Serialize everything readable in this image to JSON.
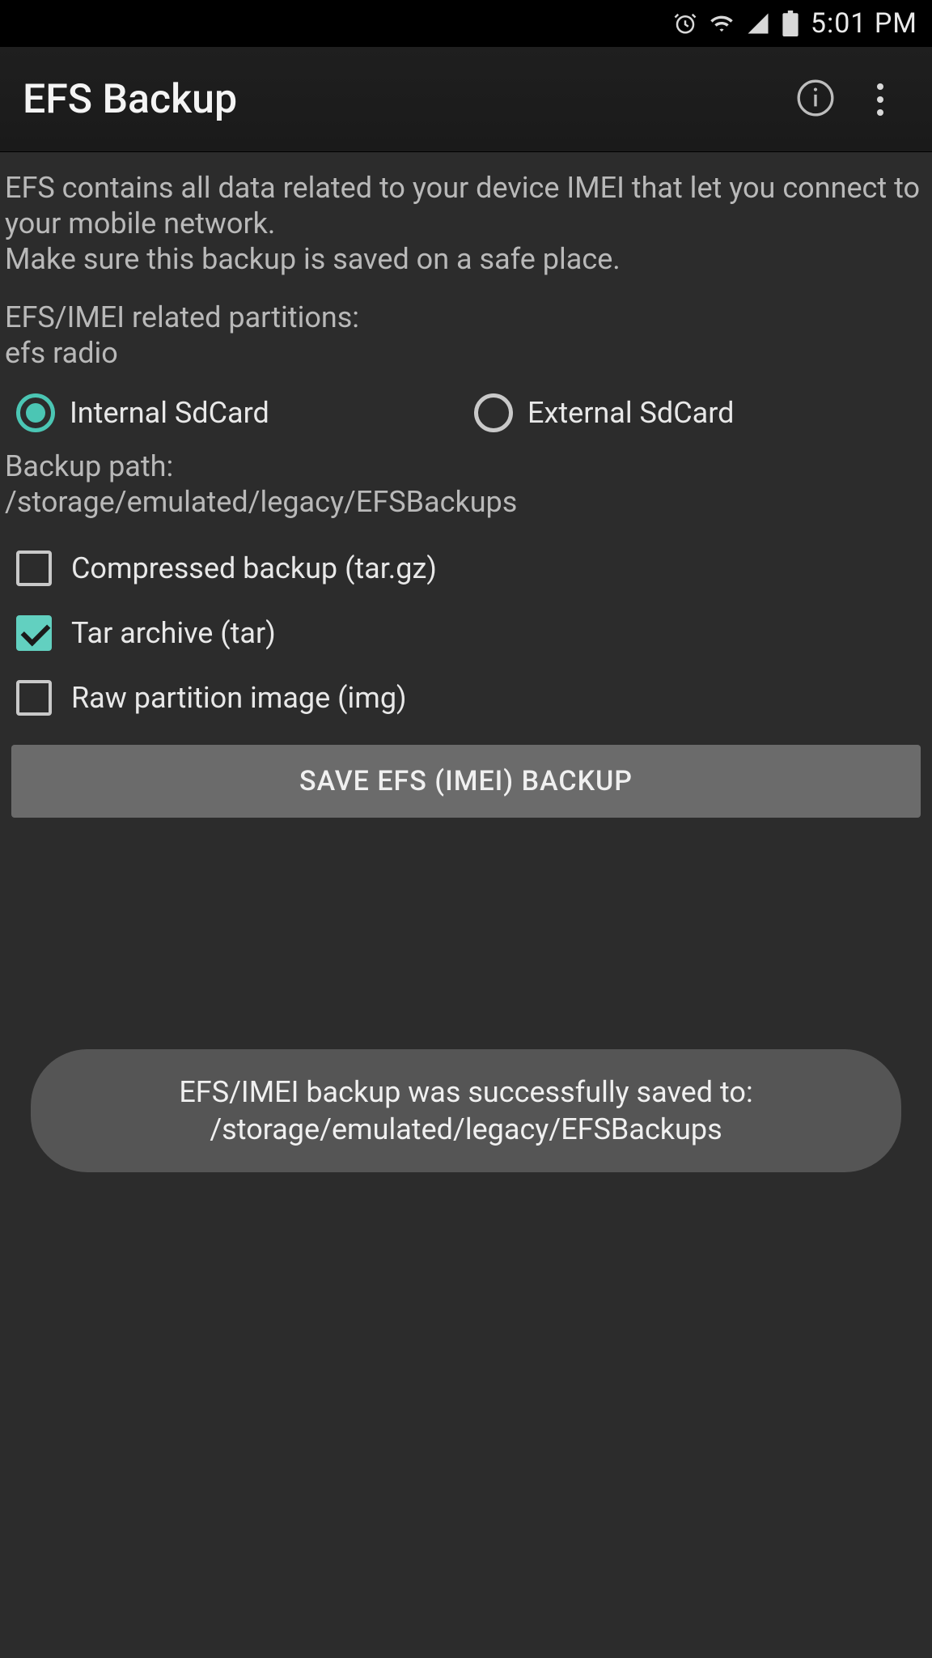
{
  "status": {
    "time": "5:01 PM"
  },
  "appbar": {
    "title": "EFS Backup"
  },
  "content": {
    "description_line1": "EFS contains all data related to your device IMEI that let you connect to your mobile network.",
    "description_line2": "Make sure this backup is saved on a safe place.",
    "partitions_header": "EFS/IMEI related partitions:",
    "partitions_list": "efs radio",
    "radio": {
      "internal": "Internal SdCard",
      "external": "External SdCard",
      "selected": "internal"
    },
    "backup_path_label": "Backup path:",
    "backup_path_value": "/storage/emulated/legacy/EFSBackups",
    "checks": {
      "compressed": {
        "label": "Compressed backup (tar.gz)",
        "checked": false
      },
      "tar": {
        "label": "Tar archive (tar)",
        "checked": true
      },
      "raw": {
        "label": "Raw partition image (img)",
        "checked": false
      }
    },
    "save_button": "SAVE EFS (IMEI) BACKUP"
  },
  "toast": {
    "line1": "EFS/IMEI backup was successfully saved to:",
    "line2": "/storage/emulated/legacy/EFSBackups"
  }
}
